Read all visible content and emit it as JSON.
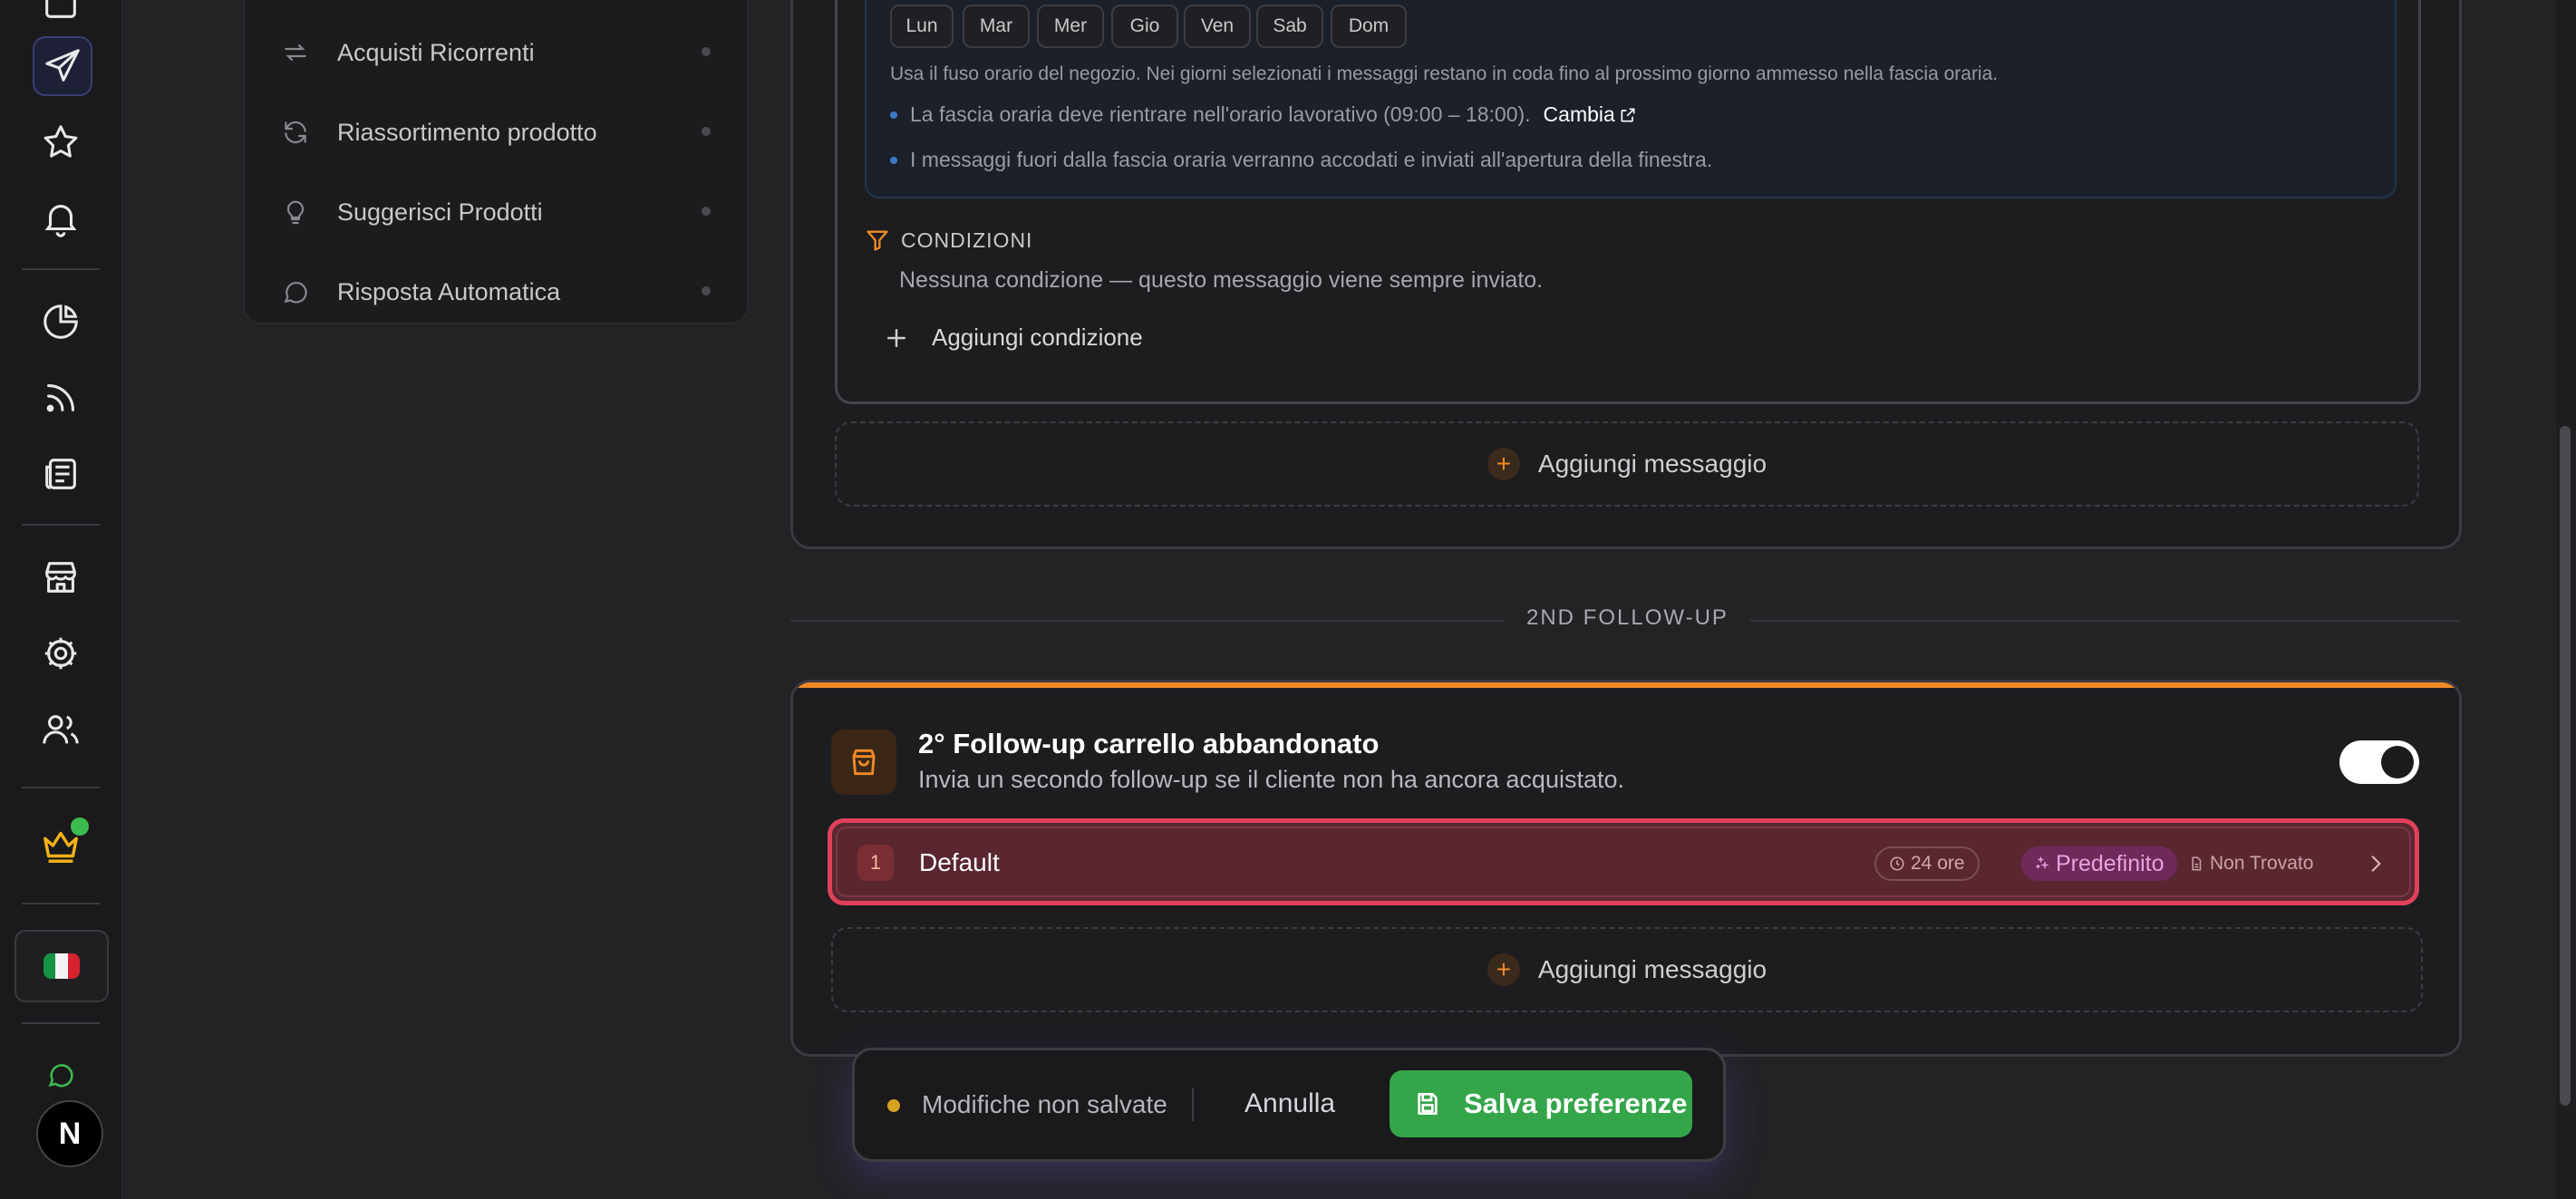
{
  "colors": {
    "accent_orange": "#f08a26",
    "save_green": "#35a54a",
    "highlight_red": "#e0415a",
    "badge_purple": "#6f2a5c"
  },
  "rail": {
    "icons": [
      "inbox-icon",
      "send-icon",
      "star-icon",
      "bell-icon",
      "pie-chart-icon",
      "rss-icon",
      "newspaper-icon",
      "store-icon",
      "settings-gear-icon",
      "users-icon",
      "crown-icon",
      "italy-flag-icon",
      "chat-icon",
      "nextjs-logo-icon"
    ],
    "avatar_letter": "N"
  },
  "subnav": {
    "items": [
      {
        "label": "Acquisti Ricorrenti",
        "icon": "repeat-icon"
      },
      {
        "label": "Riassortimento prodotto",
        "icon": "refresh-icon"
      },
      {
        "label": "Suggerisci Prodotti",
        "icon": "lightbulb-icon"
      },
      {
        "label": "Risposta Automatica",
        "icon": "chat-bubble-icon"
      }
    ]
  },
  "schedule": {
    "days": [
      "Lun",
      "Mar",
      "Mer",
      "Gio",
      "Ven",
      "Sab",
      "Dom"
    ],
    "timezone_note": "Usa il fuso orario del negozio. Nei giorni selezionati i messaggi restano in coda fino al prossimo giorno ammesso nella fascia oraria.",
    "bullet1": "La fascia oraria deve rientrare nell'orario lavorativo (09:00 – 18:00).",
    "change_link": "Cambia",
    "bullet2": "I messaggi fuori dalla fascia oraria verranno accodati e inviati all'apertura della finestra."
  },
  "conditions": {
    "title": "CONDIZIONI",
    "empty": "Nessuna condizione — questo messaggio viene sempre inviato.",
    "add_label": "Aggiungi condizione"
  },
  "add_message_label": "Aggiungi messaggio",
  "divider_label": "2ND FOLLOW-UP",
  "followup2": {
    "title": "2° Follow-up carrello abbandonato",
    "description": "Invia un secondo follow-up se il cliente non ha ancora acquistato.",
    "enabled": true,
    "message": {
      "index": "1",
      "name": "Default",
      "delay": "24 ore",
      "template_badge": "Predefinito",
      "status": "Non Trovato"
    }
  },
  "savebar": {
    "status": "Modifiche non salvate",
    "cancel": "Annulla",
    "save": "Salva preferenze"
  }
}
